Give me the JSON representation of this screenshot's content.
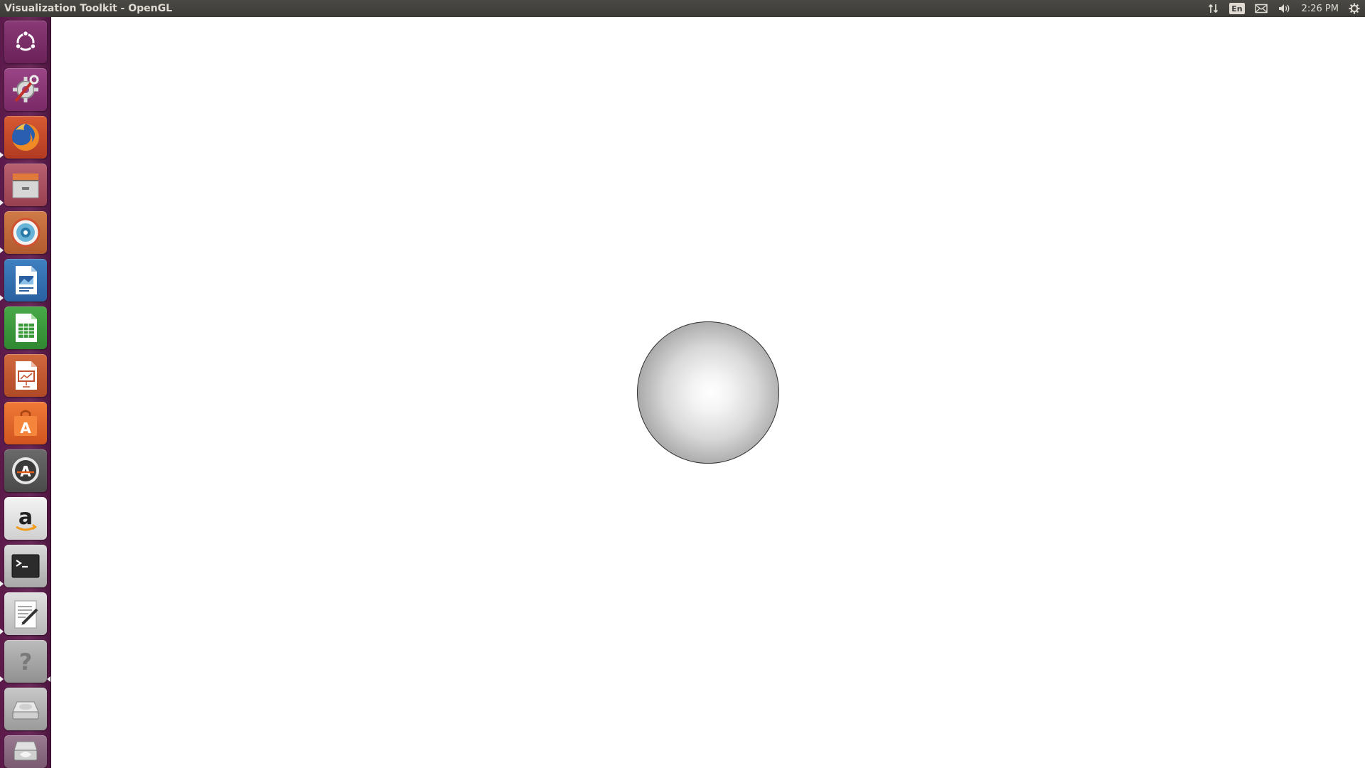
{
  "window": {
    "title": "Visualization Toolkit - OpenGL"
  },
  "panel": {
    "indicators": [
      {
        "name": "network-icon"
      },
      {
        "name": "keyboard-language",
        "label": "En"
      },
      {
        "name": "mail-icon"
      },
      {
        "name": "volume-icon"
      }
    ],
    "clock": "2:26 PM",
    "session_icon": "gear-icon"
  },
  "launcher": {
    "items": [
      {
        "name": "ubuntu-dash",
        "icon": "ubuntu-logo-icon",
        "bg": "#7a2a66"
      },
      {
        "name": "system-settings",
        "icon": "settings-tools-icon",
        "bg": "#8a3576"
      },
      {
        "name": "firefox",
        "icon": "firefox-icon",
        "bg": "#c2432a",
        "running": true
      },
      {
        "name": "files",
        "icon": "file-cabinet-icon",
        "bg": "#a8505f",
        "running": true
      },
      {
        "name": "disk-usage-analyzer",
        "icon": "target-icon",
        "bg": "#c2663a",
        "running": true
      },
      {
        "name": "libreoffice-writer",
        "icon": "document-writer-icon",
        "bg": "#2f6fae",
        "running": true
      },
      {
        "name": "libreoffice-calc",
        "icon": "spreadsheet-icon",
        "bg": "#3f9a3f"
      },
      {
        "name": "libreoffice-impress",
        "icon": "presentation-icon",
        "bg": "#c2573a"
      },
      {
        "name": "ubuntu-software",
        "icon": "software-bag-icon",
        "bg": "#e0632a"
      },
      {
        "name": "software-updater",
        "icon": "updater-icon",
        "bg": "#5a5a5a"
      },
      {
        "name": "amazon",
        "icon": "amazon-icon",
        "bg": "#e8e8e8"
      },
      {
        "name": "terminal",
        "icon": "terminal-icon",
        "bg": "#4a4a4a",
        "running": true
      },
      {
        "name": "text-editor",
        "icon": "text-editor-icon",
        "bg": "#cfcfcf",
        "running": true
      },
      {
        "name": "help",
        "icon": "question-icon",
        "bg": "#a0a0a0",
        "running": true,
        "focused": true
      },
      {
        "name": "drive",
        "icon": "hard-drive-icon",
        "bg": "#b8b8b8"
      },
      {
        "name": "trash",
        "icon": "trash-icon",
        "bg": "#8a6a80"
      }
    ]
  },
  "scene": {
    "object": "sphere",
    "background_color": "#ffffff"
  }
}
